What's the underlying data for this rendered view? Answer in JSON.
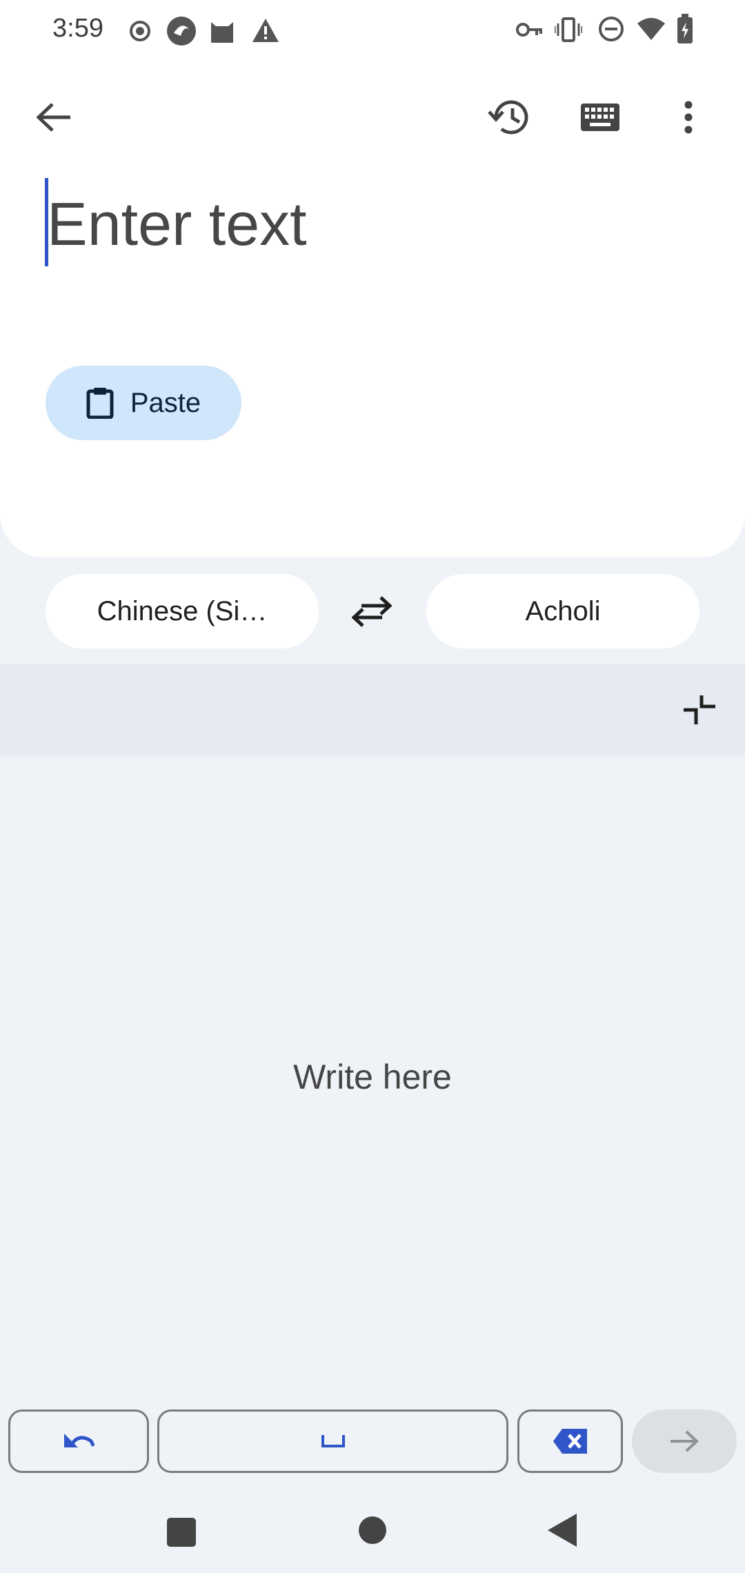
{
  "status_bar": {
    "time": "3:59"
  },
  "editor": {
    "placeholder": "Enter text"
  },
  "paste": {
    "label": "Paste"
  },
  "languages": {
    "source": "Chinese (Si…",
    "target": "Acholi"
  },
  "handwriting": {
    "prompt": "Write here"
  },
  "colors": {
    "accent": "#2f55c9",
    "paste_bg": "#cfe6fb",
    "background": "#eff3f8"
  },
  "icons": {
    "back": "arrow-left-icon",
    "history": "history-icon",
    "keyboard": "keyboard-icon",
    "more": "more-vert-icon",
    "paste": "clipboard-icon",
    "swap": "swap-icon",
    "collapse": "collapse-icon",
    "undo": "undo-icon",
    "space": "space-bar-icon",
    "delete": "backspace-icon",
    "enter": "arrow-right-icon"
  }
}
